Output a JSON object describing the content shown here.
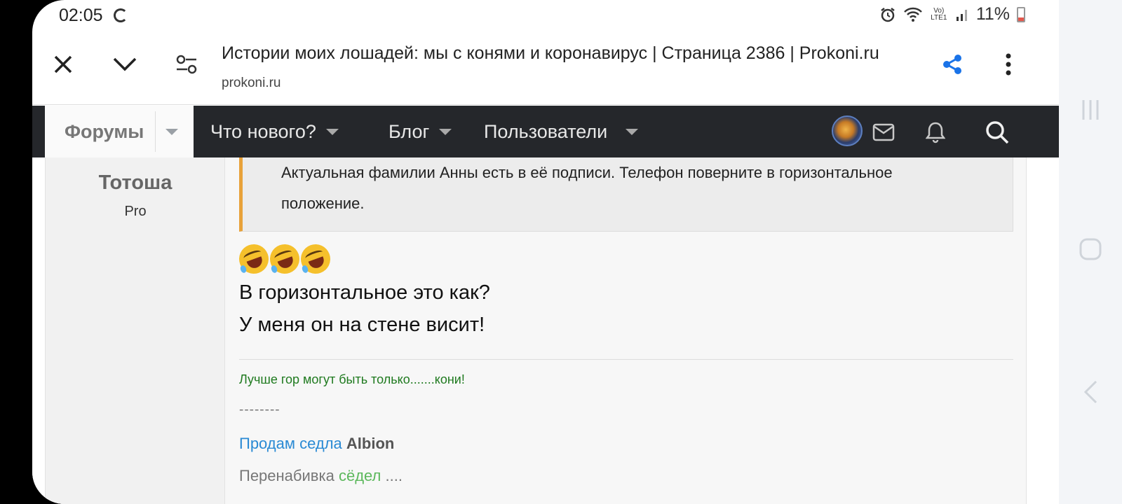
{
  "status_bar": {
    "time": "02:05",
    "network": "Vo) LTE1",
    "battery": "11%"
  },
  "browser": {
    "page_title": "Истории моих лошадей: мы с конями и коронавирус | Страница 2386 | Prokoni.ru",
    "url": "prokoni.ru",
    "icons": [
      "close-icon",
      "chevron-down-icon",
      "page-settings-icon",
      "share-icon",
      "more-icon"
    ],
    "share_color": "#1a73e8"
  },
  "forum_nav": {
    "forums": "Форумы",
    "whats_new": "Что нового?",
    "blog": "Блог",
    "members": "Пользователи",
    "icons": [
      "avatar",
      "mail-icon",
      "bell-icon",
      "search-icon"
    ]
  },
  "post": {
    "username": "Тотоша",
    "user_title": "Pro",
    "quote_lines": [
      "Актуальная фамилии Анны есть в её подписи. Телефон поверните в горизонтальное",
      "положение."
    ],
    "emoji": "rolling-on-floor-laughing-icon",
    "message_lines": [
      "В горизонтальное это как?",
      "У меня он на стене висит!"
    ],
    "signature": {
      "motto": "Лучше гор могут быть только.......кони!",
      "dashes": "--------",
      "sell_link": "Продам седла",
      "brand": "Albion",
      "restuffing": "Перенабивка",
      "saddles": "сёдел",
      "ellipsis": "...."
    }
  },
  "colors": {
    "quote_accent": "#e8a23a",
    "nav_bg": "#25272b",
    "link": "#2a8ad4",
    "signature_green": "#1f7a1f"
  }
}
